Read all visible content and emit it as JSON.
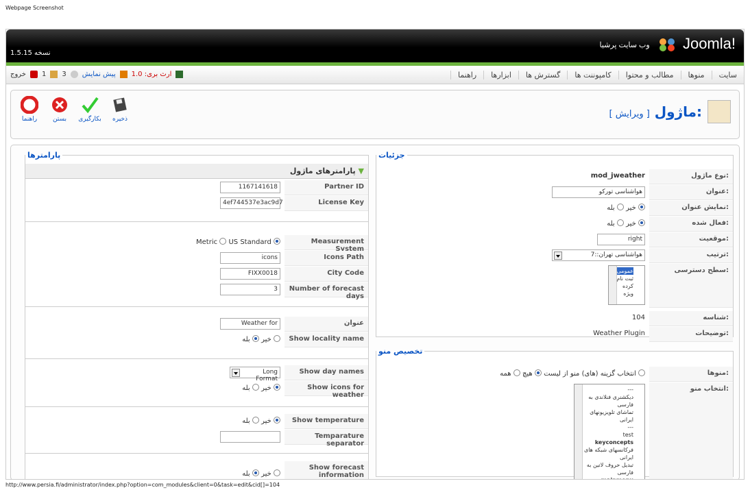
{
  "caption": "Webpage Screenshot",
  "footer_url": "http://www.persia.fi/administrator/index.php?option=com_modules&client=0&task=edit&cid[]=104",
  "header": {
    "version": "1.5.15 نسخه",
    "site_name": "وب سایت پرشیا",
    "brand": "Joomla!"
  },
  "menu": [
    "سایت",
    "منوها",
    "مطالب و محتوا",
    "کامپوننت ها",
    "گسترش ها",
    "ابزارها",
    "راهنما"
  ],
  "status": {
    "logout": "خروج",
    "messages": "1",
    "users_online": "3",
    "preview": "پیش نمایش",
    "upgrade": "ارث بری: 1.0"
  },
  "toolbar": {
    "save": "ذخیره",
    "apply": "بکارگیری",
    "close": "بستن",
    "help": "راهنما"
  },
  "page_title": {
    "main": "ماژول:",
    "sub": "[ ویرایش ]"
  },
  "details": {
    "legend": "جزئیات",
    "type_label": "نوع ماژول:",
    "type_value": "mod_jweather",
    "title_label": "عنوان:",
    "title_value": "هواشناسی تورکو",
    "show_title_label": "نمایش عنوان:",
    "no": "خیر",
    "yes": "بله",
    "enabled_label": "فعال شده:",
    "position_label": "موقعیت:",
    "position_value": "right",
    "order_label": "ترتیب:",
    "order_value": "7::هواشناسی تهران",
    "access_label": "سطح دسترسی:",
    "access_options": [
      "عمومی",
      "ثبت نام کرده",
      "ویژه"
    ],
    "id_label": "شناسه:",
    "id_value": "104",
    "desc_label": "توضیحات:",
    "desc_value": "Weather Plugin"
  },
  "menu_assign": {
    "legend": "تخصیص منو",
    "menus_label": "منوها:",
    "all": "همه",
    "none": "هیچ",
    "select": "انتخاب گزینه (های) منو از لیست",
    "select_label": "انتخاب منو:",
    "items": [
      "---",
      "دیکشنری فنلاندی به فارسی",
      "تماشای تلویزیونهای ایرانی",
      "---",
      "test",
      "keyconcepts",
      "فرکانسهای شبکه های ایرانی",
      "تبدیل حروف لاتین به فارسی",
      "mainmenu"
    ]
  },
  "params": {
    "legend": "پارامترها",
    "section": "پارامترهای ماژول",
    "partner_label": "Partner ID",
    "partner_value": "1167141618",
    "license_label": "License Key",
    "license_value": "4ef744537e3ac9d7",
    "measure_label": "Measurement System",
    "metric": "Metric",
    "us": "US Standard",
    "icons_label": "Icons Path",
    "icons_value": "icons",
    "city_label": "City Code",
    "city_value": "FIXX0018",
    "days_label": "Number of forecast days",
    "days_value": "3",
    "title_label": "عنوان",
    "title_value": "Weather for",
    "locality_label": "Show locality name",
    "yes": "بله",
    "no": "خیر",
    "daynames_label": "Show day names",
    "daynames_value": "Long Format",
    "icons_weather_label": "Show icons for weather",
    "temp_label": "Show temperature",
    "tempsep_label": "Temparature separator",
    "forecast_label": "Show forecast information"
  }
}
